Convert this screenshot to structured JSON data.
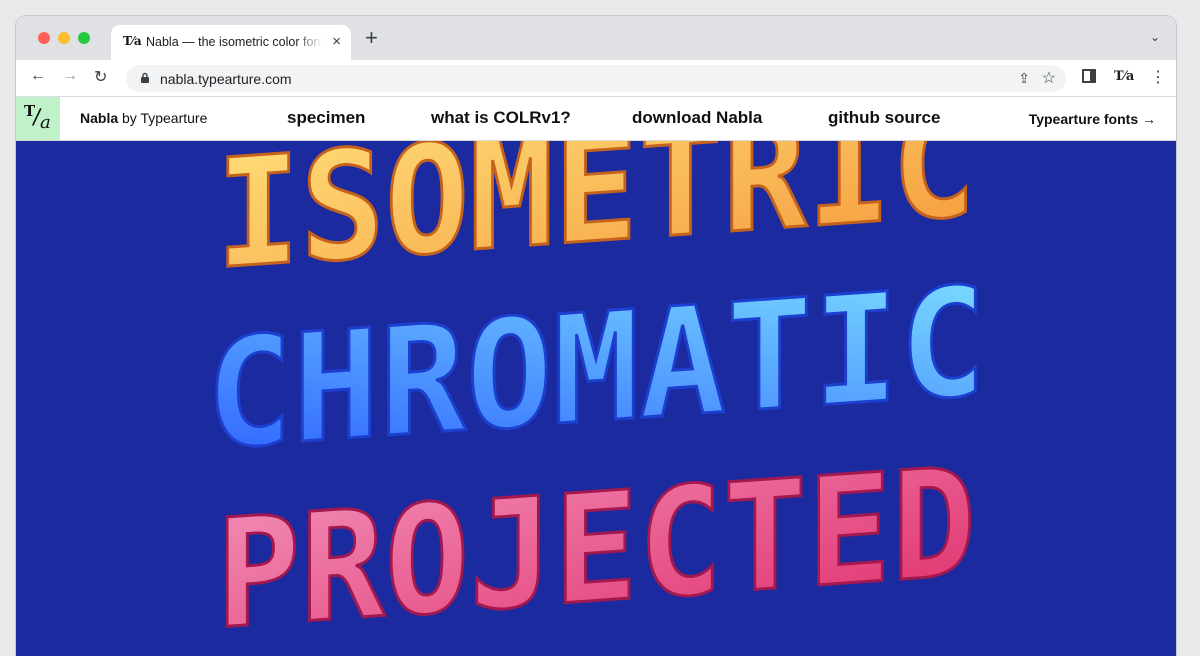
{
  "browser": {
    "tab_title": "Nabla — the isometric color font",
    "tab_favicon": "T⁄a",
    "tab_close": "×",
    "new_tab": "+",
    "url": "nabla.typearture.com",
    "icons": [
      "lock-icon",
      "share-icon",
      "star-icon",
      "side-panel-icon",
      "extension-icon",
      "menu-icon",
      "back-icon",
      "forward-icon",
      "reload-icon"
    ]
  },
  "site": {
    "brand_name": "Nabla",
    "brand_by": "by Typearture",
    "nav": [
      "specimen",
      "what is COLRv1?",
      "download Nabla",
      "github source"
    ],
    "right_link": "Typearture fonts →",
    "logo_color": "#bff2c8"
  },
  "hero": {
    "background": "#1b2a9e",
    "lines": [
      {
        "text": "ISOMETRIC",
        "colors": [
          "#ffe07a",
          "#f59a3c"
        ]
      },
      {
        "text": "CHROMATIC",
        "colors": [
          "#7fe3ff",
          "#2a5cff"
        ]
      },
      {
        "text": "PROJECTED",
        "colors": [
          "#f28fb8",
          "#e0306d"
        ]
      }
    ]
  }
}
